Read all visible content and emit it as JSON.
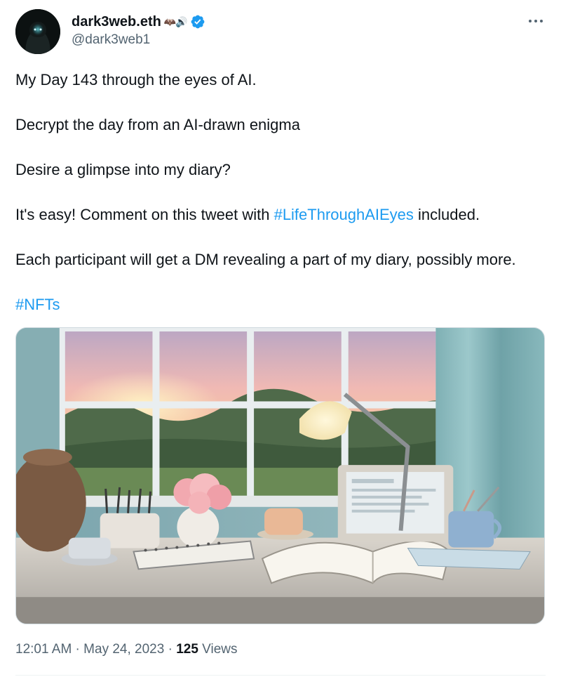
{
  "author": {
    "display_name": "dark3web.eth",
    "name_emoji": "🦇🔊",
    "handle": "@dark3web1",
    "verified": true
  },
  "tweet": {
    "line1": "My Day 143 through the eyes of AI.",
    "line2": "Decrypt the day from an AI-drawn enigma",
    "line3": "Desire a glimpse into my diary?",
    "line4_before": "It's easy! Comment on this tweet with ",
    "line4_hashtag": "#LifeThroughAIEyes",
    "line4_after": " included.",
    "line5": "Each participant will get a DM revealing a part of my diary, possibly more.",
    "hashtag2": "#NFTs"
  },
  "meta": {
    "time": "12:01 AM",
    "separator": " · ",
    "date": "May 24, 2023",
    "views_count": "125",
    "views_label": " Views"
  },
  "colors": {
    "link": "#1d9bf0",
    "secondary": "#536471",
    "text": "#0f1419"
  },
  "icons": [
    "verified-badge-icon",
    "more-icon"
  ]
}
